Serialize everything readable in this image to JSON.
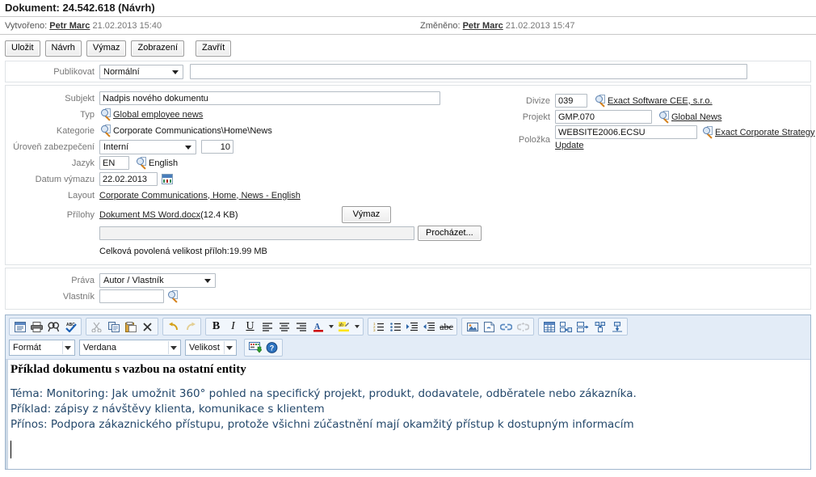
{
  "header": {
    "title": "Dokument: 24.542.618 (Návrh)",
    "created_label": "Vytvořeno:",
    "created_user": "Petr Marc",
    "created_date": "21.02.2013 15:40",
    "changed_label": "Změněno:",
    "changed_user": "Petr Marc",
    "changed_date": "21.02.2013 15:47"
  },
  "toolbar_buttons": {
    "save": "Uložit",
    "draft": "Návrh",
    "delete": "Výmaz",
    "view": "Zobrazení",
    "close": "Zavřít"
  },
  "publish": {
    "label": "Publikovat",
    "value": "Normální",
    "note_value": ""
  },
  "form_left": {
    "subject_label": "Subjekt",
    "subject_value": "Nadpis nového dokumentu",
    "type_label": "Typ",
    "type_value": "Global employee news",
    "category_label": "Kategorie",
    "category_value": "Corporate Communications\\Home\\News",
    "security_label": "Úroveň zabezpečení",
    "security_value": "Interní",
    "security_number": "10",
    "language_label": "Jazyk",
    "language_code": "EN",
    "language_name": "English",
    "deletedate_label": "Datum výmazu",
    "deletedate_value": "22.02.2013",
    "layout_label": "Layout",
    "layout_value": "Corporate Communications, Home, News - English",
    "attachments_label": "Přílohy",
    "attachment_name": "Dokument MS Word.docx",
    "attachment_size": "(12.4 KB)",
    "attachment_delete_button": "Výmaz",
    "browse_button": "Procházet...",
    "browse_value": "",
    "size_note": "Celková povolená velikost příloh:19.99 MB"
  },
  "form_right": {
    "division_label": "Divize",
    "division_value": "039",
    "division_link": "Exact Software CEE, s.r.o.",
    "project_label": "Projekt",
    "project_value": "GMP.070",
    "project_link": "Global News",
    "item_label": "Položka",
    "item_value": "WEBSITE2006.ECSU",
    "item_link": "Exact Corporate Strategy",
    "item_link2": "Update"
  },
  "rights": {
    "rights_label": "Práva",
    "rights_value": "Autor / Vlastník",
    "owner_label": "Vlastník",
    "owner_value": ""
  },
  "editor": {
    "format_select": "Formát",
    "font_select": "Verdana",
    "size_select": "Velikost",
    "icons_row1": [
      "source-icon",
      "print-icon",
      "find-icon",
      "spellcheck-icon",
      "cut-icon",
      "copy-icon",
      "paste-icon",
      "remove-format-icon",
      "undo-icon",
      "redo-icon",
      "bold-icon",
      "italic-icon",
      "underline-icon",
      "align-left-icon",
      "align-center-icon",
      "align-right-icon",
      "text-color-icon",
      "text-color-dropdown-icon",
      "highlight-color-icon",
      "highlight-color-dropdown-icon",
      "numbered-list-icon",
      "bulleted-list-icon",
      "indent-icon",
      "outdent-icon",
      "strikethrough-icon",
      "image-icon",
      "document-icon",
      "link-icon",
      "unlink-icon",
      "table-icon",
      "insert-column-icon",
      "insert-row-icon",
      "merge-cells-icon",
      "split-cells-icon"
    ],
    "icons_row2": [
      "template-insert-icon",
      "help-icon"
    ],
    "content_heading": "Příklad dokumentu s vazbou na ostatní entity",
    "content_lines": [
      "Téma: Monitoring: Jak umožnit 360° pohled na specifický projekt, produkt, dodavatele, odběratele nebo zákazníka.",
      "Příklad: zápisy z návštěvy klienta, komunikace s klientem",
      "Přínos: Podpora zákaznického přístupu, protože všichni zúčastnění mají okamžitý přístup k dostupným informacím"
    ]
  },
  "colors": {
    "panel_border": "#dfe3e6",
    "toolbar_bg": "#e3ecf7",
    "editor_border": "#9fb6cd",
    "label_text": "#777777",
    "body_text": "#24486b"
  }
}
